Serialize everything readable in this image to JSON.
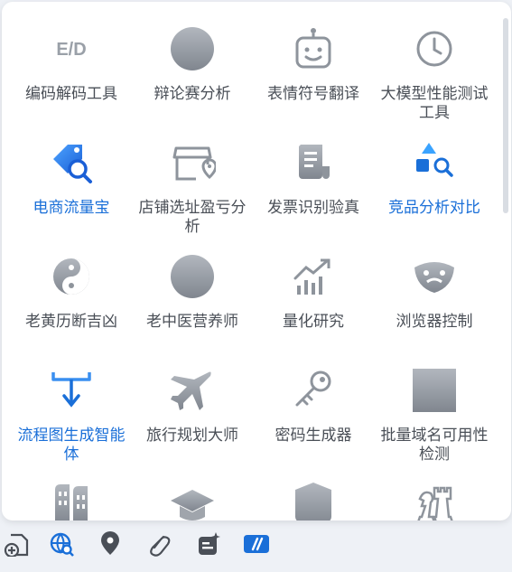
{
  "tools": [
    {
      "label": "编码解码工具",
      "icon": "ed-text-icon",
      "highlight": false
    },
    {
      "label": "辩论赛分析",
      "icon": "circle-placeholder-icon",
      "highlight": false
    },
    {
      "label": "表情符号翻译",
      "icon": "robot-face-icon",
      "highlight": false
    },
    {
      "label": "大模型性能测试工具",
      "icon": "clock-icon",
      "highlight": false
    },
    {
      "label": "电商流量宝",
      "icon": "price-tag-search-icon",
      "highlight": true
    },
    {
      "label": "店铺选址盈亏分析",
      "icon": "shop-location-icon",
      "highlight": false
    },
    {
      "label": "发票识别验真",
      "icon": "invoice-icon",
      "highlight": false
    },
    {
      "label": "竞品分析对比",
      "icon": "shapes-search-icon",
      "highlight": true
    },
    {
      "label": "老黄历断吉凶",
      "icon": "yin-yang-icon",
      "highlight": false
    },
    {
      "label": "老中医营养师",
      "icon": "circle-placeholder-icon",
      "highlight": false
    },
    {
      "label": "量化研究",
      "icon": "bar-chart-up-icon",
      "highlight": false
    },
    {
      "label": "浏览器控制",
      "icon": "theater-masks-icon",
      "highlight": false
    },
    {
      "label": "流程图生成智能体",
      "icon": "flow-branch-icon",
      "highlight": true
    },
    {
      "label": "旅行规划大师",
      "icon": "airplane-icon",
      "highlight": false
    },
    {
      "label": "密码生成器",
      "icon": "key-icon",
      "highlight": false
    },
    {
      "label": "批量域名可用性检测",
      "icon": "square-placeholder-icon",
      "highlight": false
    },
    {
      "label": "",
      "icon": "buildings-icon",
      "highlight": false
    },
    {
      "label": "",
      "icon": "graduation-cap-icon",
      "highlight": false
    },
    {
      "label": "",
      "icon": "shield-icon",
      "highlight": false
    },
    {
      "label": "",
      "icon": "chess-pieces-icon",
      "highlight": false
    }
  ],
  "toolbar": [
    {
      "icon": "add-document-icon"
    },
    {
      "icon": "globe-search-icon"
    },
    {
      "icon": "map-pin-icon"
    },
    {
      "icon": "paperclip-icon"
    },
    {
      "icon": "sparkle-list-icon"
    },
    {
      "icon": "slash-code-icon"
    }
  ],
  "colors": {
    "accent": "#1a6fd8",
    "icon_gray": "#8e949c",
    "text": "#4a4f57"
  }
}
